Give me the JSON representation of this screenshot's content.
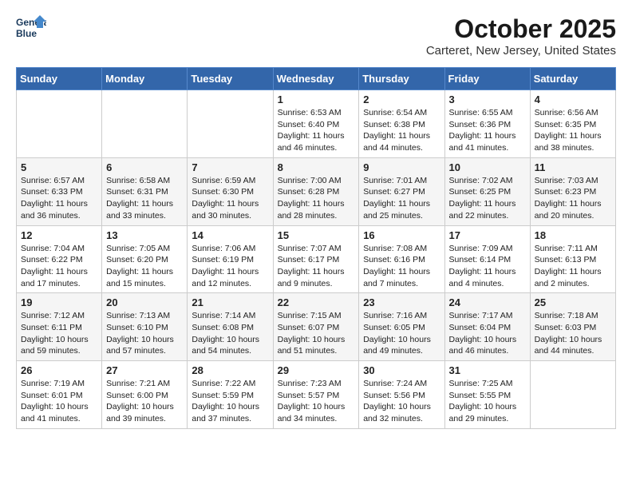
{
  "header": {
    "logo_line1": "General",
    "logo_line2": "Blue",
    "title": "October 2025",
    "location": "Carteret, New Jersey, United States"
  },
  "days_of_week": [
    "Sunday",
    "Monday",
    "Tuesday",
    "Wednesday",
    "Thursday",
    "Friday",
    "Saturday"
  ],
  "weeks": [
    [
      {
        "day": "",
        "content": ""
      },
      {
        "day": "",
        "content": ""
      },
      {
        "day": "",
        "content": ""
      },
      {
        "day": "1",
        "content": "Sunrise: 6:53 AM\nSunset: 6:40 PM\nDaylight: 11 hours\nand 46 minutes."
      },
      {
        "day": "2",
        "content": "Sunrise: 6:54 AM\nSunset: 6:38 PM\nDaylight: 11 hours\nand 44 minutes."
      },
      {
        "day": "3",
        "content": "Sunrise: 6:55 AM\nSunset: 6:36 PM\nDaylight: 11 hours\nand 41 minutes."
      },
      {
        "day": "4",
        "content": "Sunrise: 6:56 AM\nSunset: 6:35 PM\nDaylight: 11 hours\nand 38 minutes."
      }
    ],
    [
      {
        "day": "5",
        "content": "Sunrise: 6:57 AM\nSunset: 6:33 PM\nDaylight: 11 hours\nand 36 minutes."
      },
      {
        "day": "6",
        "content": "Sunrise: 6:58 AM\nSunset: 6:31 PM\nDaylight: 11 hours\nand 33 minutes."
      },
      {
        "day": "7",
        "content": "Sunrise: 6:59 AM\nSunset: 6:30 PM\nDaylight: 11 hours\nand 30 minutes."
      },
      {
        "day": "8",
        "content": "Sunrise: 7:00 AM\nSunset: 6:28 PM\nDaylight: 11 hours\nand 28 minutes."
      },
      {
        "day": "9",
        "content": "Sunrise: 7:01 AM\nSunset: 6:27 PM\nDaylight: 11 hours\nand 25 minutes."
      },
      {
        "day": "10",
        "content": "Sunrise: 7:02 AM\nSunset: 6:25 PM\nDaylight: 11 hours\nand 22 minutes."
      },
      {
        "day": "11",
        "content": "Sunrise: 7:03 AM\nSunset: 6:23 PM\nDaylight: 11 hours\nand 20 minutes."
      }
    ],
    [
      {
        "day": "12",
        "content": "Sunrise: 7:04 AM\nSunset: 6:22 PM\nDaylight: 11 hours\nand 17 minutes."
      },
      {
        "day": "13",
        "content": "Sunrise: 7:05 AM\nSunset: 6:20 PM\nDaylight: 11 hours\nand 15 minutes."
      },
      {
        "day": "14",
        "content": "Sunrise: 7:06 AM\nSunset: 6:19 PM\nDaylight: 11 hours\nand 12 minutes."
      },
      {
        "day": "15",
        "content": "Sunrise: 7:07 AM\nSunset: 6:17 PM\nDaylight: 11 hours\nand 9 minutes."
      },
      {
        "day": "16",
        "content": "Sunrise: 7:08 AM\nSunset: 6:16 PM\nDaylight: 11 hours\nand 7 minutes."
      },
      {
        "day": "17",
        "content": "Sunrise: 7:09 AM\nSunset: 6:14 PM\nDaylight: 11 hours\nand 4 minutes."
      },
      {
        "day": "18",
        "content": "Sunrise: 7:11 AM\nSunset: 6:13 PM\nDaylight: 11 hours\nand 2 minutes."
      }
    ],
    [
      {
        "day": "19",
        "content": "Sunrise: 7:12 AM\nSunset: 6:11 PM\nDaylight: 10 hours\nand 59 minutes."
      },
      {
        "day": "20",
        "content": "Sunrise: 7:13 AM\nSunset: 6:10 PM\nDaylight: 10 hours\nand 57 minutes."
      },
      {
        "day": "21",
        "content": "Sunrise: 7:14 AM\nSunset: 6:08 PM\nDaylight: 10 hours\nand 54 minutes."
      },
      {
        "day": "22",
        "content": "Sunrise: 7:15 AM\nSunset: 6:07 PM\nDaylight: 10 hours\nand 51 minutes."
      },
      {
        "day": "23",
        "content": "Sunrise: 7:16 AM\nSunset: 6:05 PM\nDaylight: 10 hours\nand 49 minutes."
      },
      {
        "day": "24",
        "content": "Sunrise: 7:17 AM\nSunset: 6:04 PM\nDaylight: 10 hours\nand 46 minutes."
      },
      {
        "day": "25",
        "content": "Sunrise: 7:18 AM\nSunset: 6:03 PM\nDaylight: 10 hours\nand 44 minutes."
      }
    ],
    [
      {
        "day": "26",
        "content": "Sunrise: 7:19 AM\nSunset: 6:01 PM\nDaylight: 10 hours\nand 41 minutes."
      },
      {
        "day": "27",
        "content": "Sunrise: 7:21 AM\nSunset: 6:00 PM\nDaylight: 10 hours\nand 39 minutes."
      },
      {
        "day": "28",
        "content": "Sunrise: 7:22 AM\nSunset: 5:59 PM\nDaylight: 10 hours\nand 37 minutes."
      },
      {
        "day": "29",
        "content": "Sunrise: 7:23 AM\nSunset: 5:57 PM\nDaylight: 10 hours\nand 34 minutes."
      },
      {
        "day": "30",
        "content": "Sunrise: 7:24 AM\nSunset: 5:56 PM\nDaylight: 10 hours\nand 32 minutes."
      },
      {
        "day": "31",
        "content": "Sunrise: 7:25 AM\nSunset: 5:55 PM\nDaylight: 10 hours\nand 29 minutes."
      },
      {
        "day": "",
        "content": ""
      }
    ]
  ]
}
